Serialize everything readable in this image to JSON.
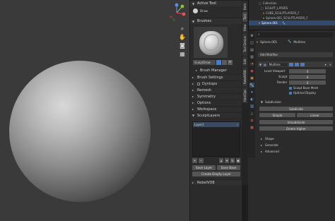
{
  "viewport": {
    "sphere": "sphere-mesh"
  },
  "tool_panel": {
    "active_tool_header": "Active Tool",
    "active_tool_name": "Draw",
    "brushes_header": "Brushes",
    "brush_name": "SculptDraw",
    "brush_manager": "Brush Manager",
    "sections": [
      "Brush Settings",
      "Dyntopo",
      "Remesh",
      "Symmetry",
      "Options",
      "Workspace",
      "SculptLayers"
    ],
    "layer_item": "Layer1",
    "buttons": {
      "save_layer": "Save Layer",
      "save_base": "Save Base",
      "create_empty": "Create Empty Layer"
    },
    "rebel_vdb": "RebelVDB"
  },
  "vtabs": [
    "Item",
    "Tool",
    "View",
    "Tool Genius",
    "Edit",
    "RebelVDB",
    "HardOps"
  ],
  "outliner": {
    "rows": [
      "Collection",
      "SCULPT_LAYERS",
      "CUBE_SCULPTLAYERS_F",
      "Sphere.001_SCULPTLAYERS_F",
      "Sphere.001"
    ]
  },
  "properties": {
    "object_name": "Sphere.001",
    "modifier_tab": "Multires",
    "add_modifier": "Add Modifier",
    "modifier_name": "Multires",
    "level_viewport_label": "Level Viewport",
    "level_viewport": "4",
    "sculpt_label": "Sculpt",
    "sculpt": "4",
    "render_label": "Render",
    "render": "4",
    "sculpt_base_mesh": "Sculpt Base Mesh",
    "optimal_display": "Optimal Display",
    "subdivision_header": "Subdivision",
    "subdivide": "Subdivide",
    "simple": "Simple",
    "linear": "Linear",
    "unsubdivide": "Unsubdivide",
    "delete_higher": "Delete Higher",
    "shape": "Shape",
    "generate": "Generate",
    "advanced": "Advanced"
  },
  "colors": {
    "accent": "#4a7cc0",
    "panel": "#2b2b2b",
    "viewport": "#3a3a3a"
  }
}
